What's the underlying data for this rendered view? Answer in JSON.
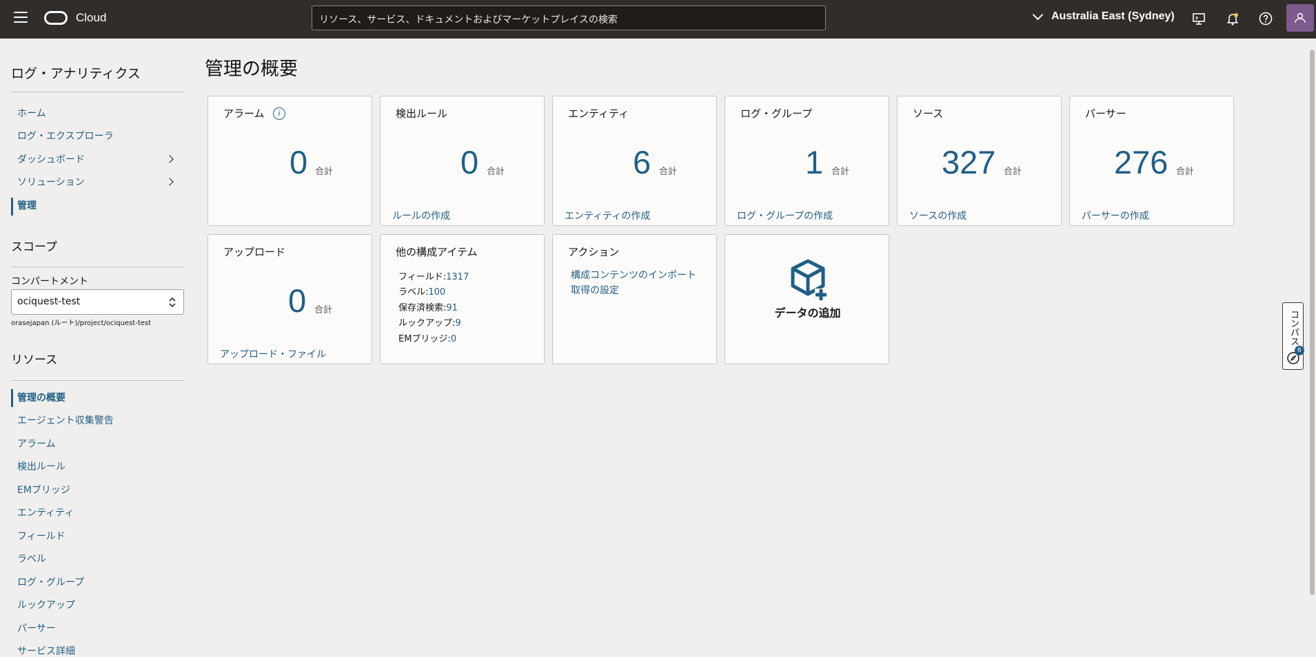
{
  "header": {
    "brand": "Cloud",
    "search_placeholder": "リソース、サービス、ドキュメントおよびマーケットプレイスの検索",
    "region": "Australia East (Sydney)"
  },
  "sidebar": {
    "title": "ログ・アナリティクス",
    "nav": [
      {
        "label": "ホーム"
      },
      {
        "label": "ログ・エクスプローラ"
      },
      {
        "label": "ダッシュボード"
      },
      {
        "label": "ソリューション"
      },
      {
        "label": "管理"
      }
    ],
    "scope_heading": "スコープ",
    "compartment_label": "コンパートメント",
    "compartment_value": "ociquest-test",
    "compartment_path": "orasejapan (ルート)/project/ociquest-test",
    "resources_heading": "リソース",
    "resources": [
      {
        "label": "管理の概要"
      },
      {
        "label": "エージェント収集警告"
      },
      {
        "label": "アラーム"
      },
      {
        "label": "検出ルール"
      },
      {
        "label": "EMブリッジ"
      },
      {
        "label": "エンティティ"
      },
      {
        "label": "フィールド"
      },
      {
        "label": "ラベル"
      },
      {
        "label": "ログ・グループ"
      },
      {
        "label": "ルックアップ"
      },
      {
        "label": "パーサー"
      },
      {
        "label": "サービス詳細"
      }
    ]
  },
  "main": {
    "page_title": "管理の概要",
    "total_label": "合計",
    "cards": [
      {
        "title": "アラーム",
        "value": "0",
        "link": ""
      },
      {
        "title": "検出ルール",
        "value": "0",
        "link": "ルールの作成"
      },
      {
        "title": "エンティティ",
        "value": "6",
        "link": "エンティティの作成"
      },
      {
        "title": "ログ・グループ",
        "value": "1",
        "link": "ログ・グループの作成"
      },
      {
        "title": "ソース",
        "value": "327",
        "link": "ソースの作成"
      },
      {
        "title": "パーサー",
        "value": "276",
        "link": "パーサーの作成"
      },
      {
        "title": "アップロード",
        "value": "0",
        "link": "アップロード・ファイル"
      }
    ],
    "other_items": {
      "title": "他の構成アイテム",
      "rows": [
        {
          "key": "フィールド:",
          "value": "1317"
        },
        {
          "key": "ラベル:",
          "value": "100"
        },
        {
          "key": "保存済検索:",
          "value": "91"
        },
        {
          "key": "ルックアップ:",
          "value": "9"
        },
        {
          "key": "EMブリッジ:",
          "value": "0"
        }
      ]
    },
    "actions": {
      "title": "アクション",
      "links": [
        "構成コンテンツのインポート",
        "取得の設定"
      ]
    },
    "add_data": "データの追加"
  },
  "compass": {
    "label": "コンパス",
    "badge": "6"
  },
  "colors": {
    "header_bg": "#312d2a",
    "accent": "#1f5f85",
    "page_bg": "#f1efed"
  }
}
